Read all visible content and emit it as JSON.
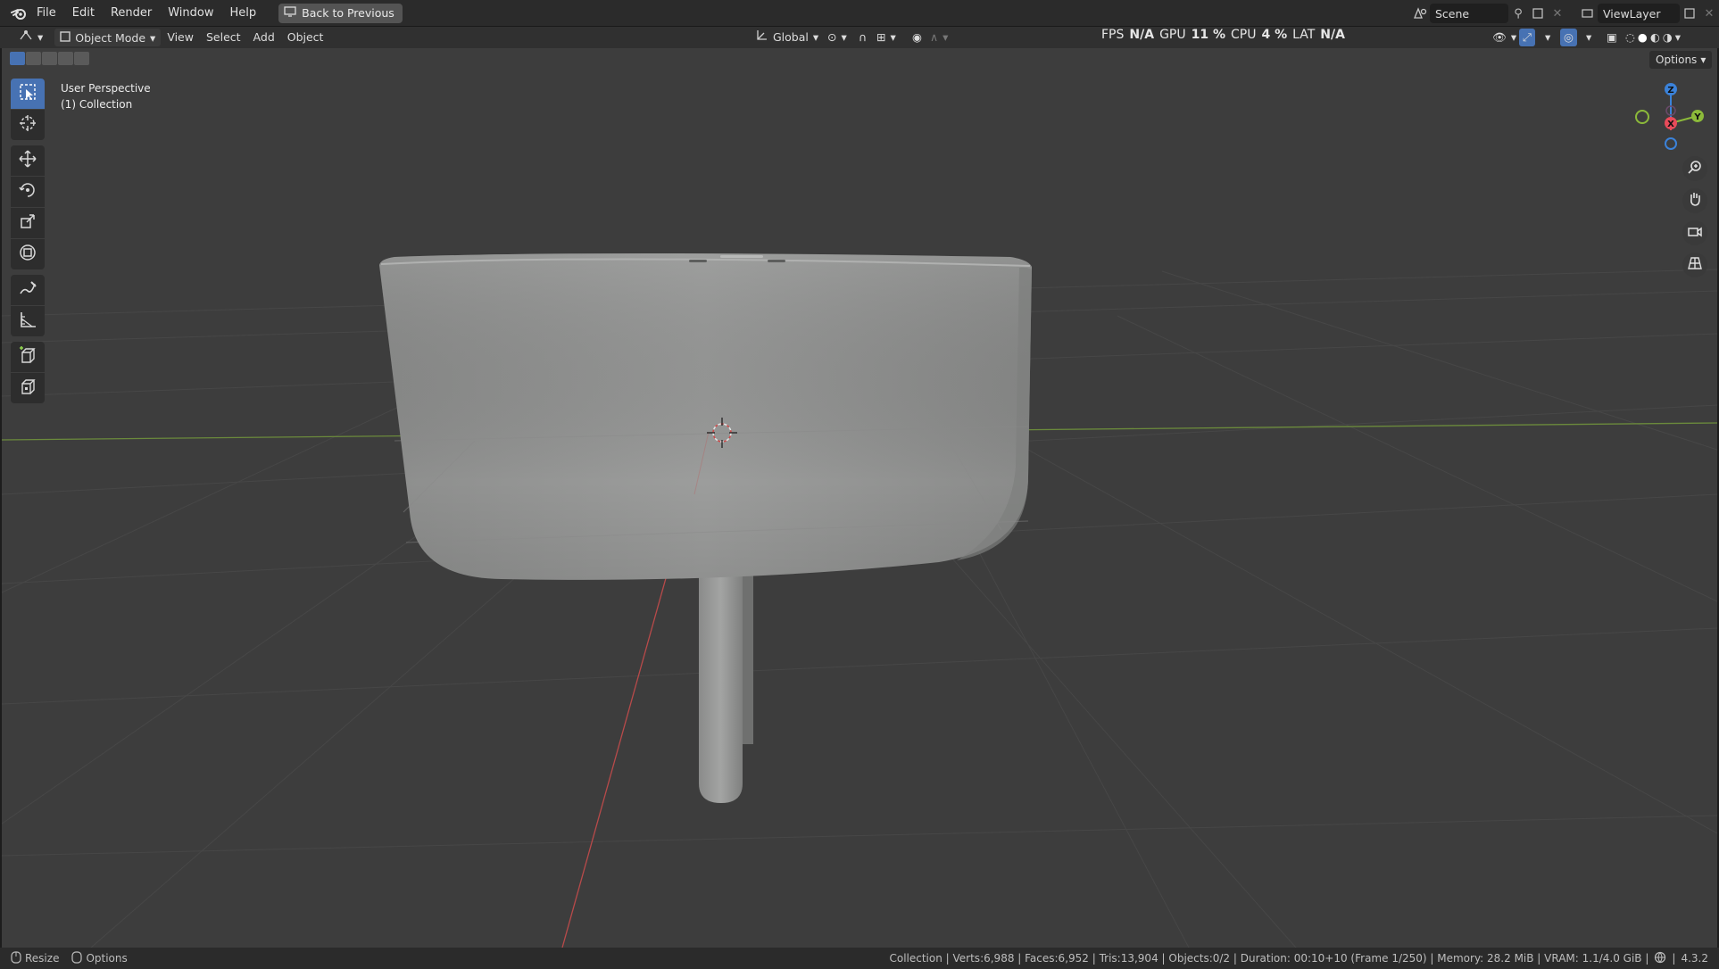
{
  "menu": {
    "items": [
      "File",
      "Edit",
      "Render",
      "Window",
      "Help"
    ],
    "back_button": "Back to Previous"
  },
  "top_right": {
    "scene_label": "Scene",
    "view_layer_label": "ViewLayer"
  },
  "header": {
    "mode": "Object Mode",
    "menus": [
      "View",
      "Select",
      "Add",
      "Object"
    ],
    "transform_orientation": "Global",
    "options_label": "Options"
  },
  "stats": {
    "fps_label": "FPS",
    "fps_value": "N/A",
    "gpu_label": "GPU",
    "gpu_value": "11 %",
    "cpu_label": "CPU",
    "cpu_value": "4 %",
    "lat_label": "LAT",
    "lat_value": "N/A"
  },
  "viewport": {
    "perspective": "User Perspective",
    "collection": "(1) Collection",
    "background_color": "#3d3d3d",
    "object_color": "#9a9b9a"
  },
  "gizmo": {
    "z": "Z",
    "y": "Y",
    "x": "X",
    "x_color": "#e84b5a",
    "y_color": "#8cba3a",
    "z_color": "#3b82d9"
  },
  "toolbar": {
    "tools": [
      "select-box",
      "cursor",
      "move",
      "rotate",
      "scale",
      "transform",
      "annotate",
      "measure",
      "add-cube",
      "add-mesh"
    ]
  },
  "status": {
    "left": [
      "Resize",
      "Options"
    ],
    "right": "Collection | Verts:6,988 | Faces:6,952 | Tris:13,904 | Objects:0/2 | Duration: 00:10+10 (Frame 1/250) | Memory: 28.2 MiB | VRAM: 1.1/4.0 GiB |",
    "version": "4.3.2"
  }
}
